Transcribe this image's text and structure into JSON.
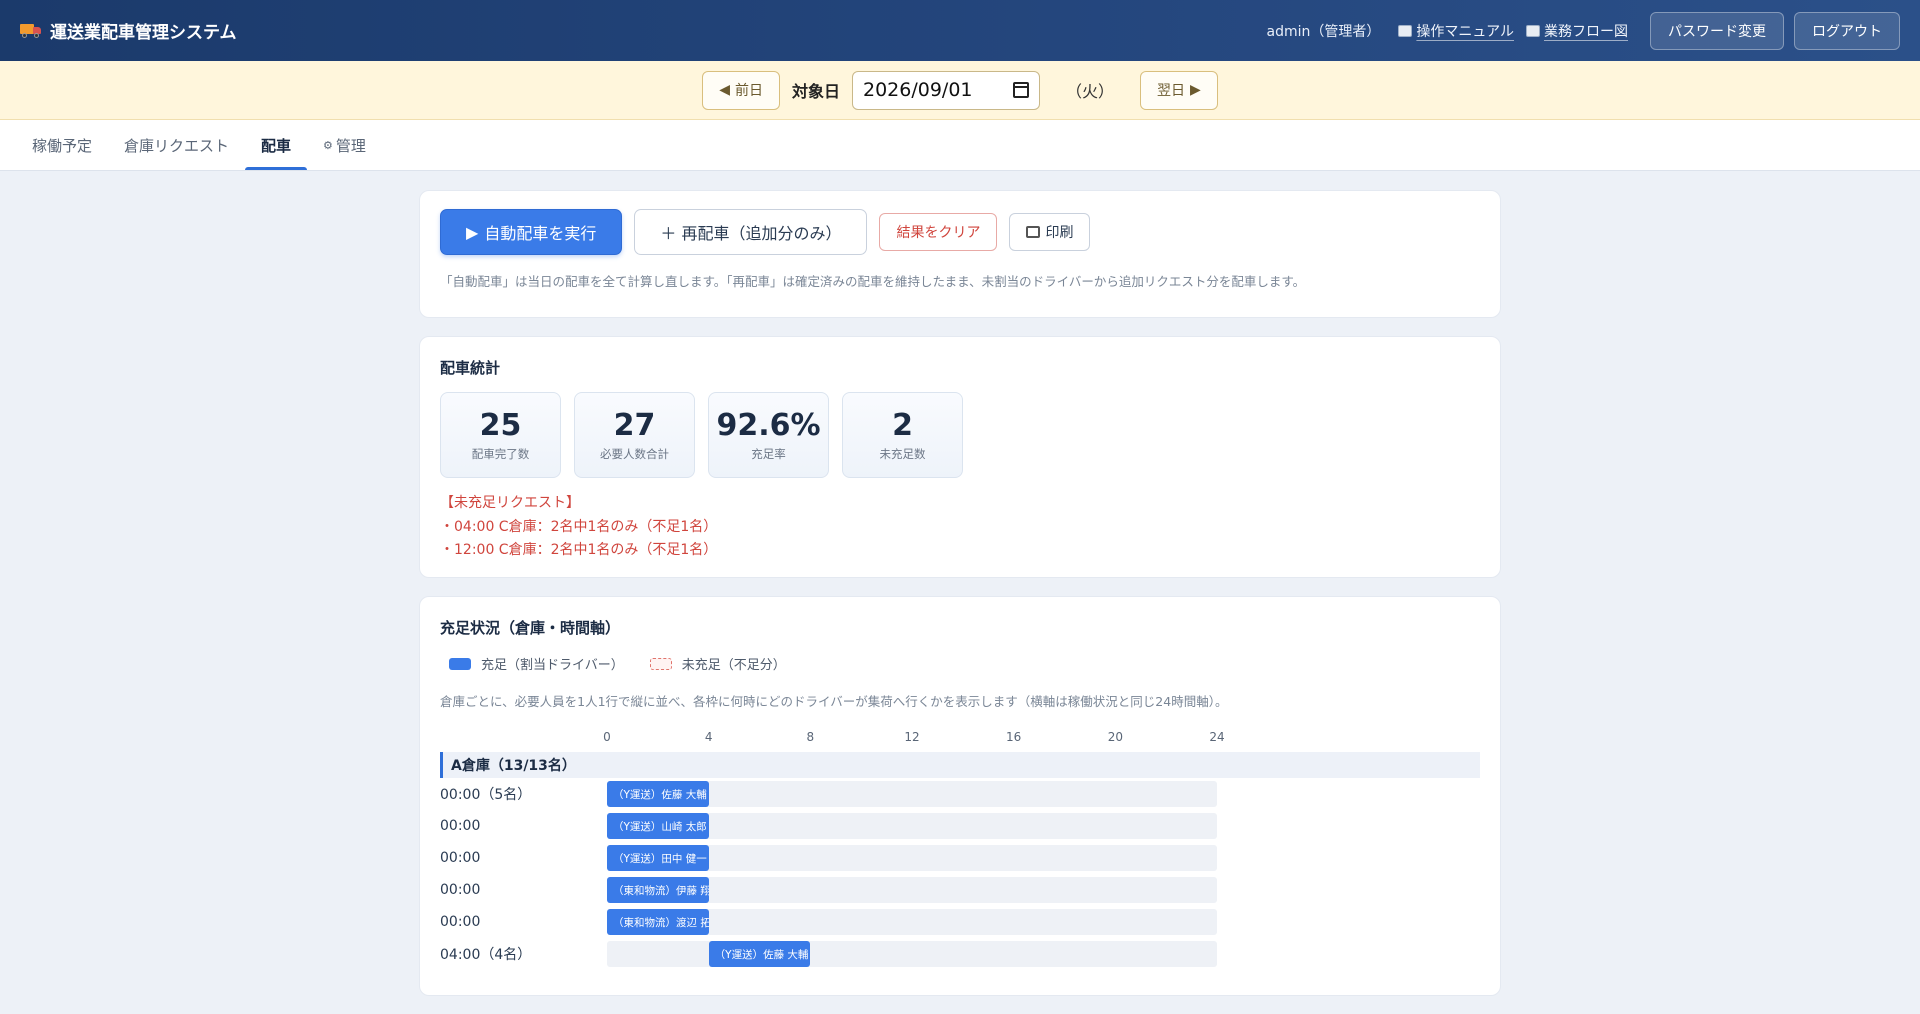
{
  "header": {
    "app_title": "運送業配車管理システム",
    "user": "admin（管理者）",
    "manual_link": "操作マニュアル",
    "flow_link": "業務フロー図",
    "password_button": "パスワード変更",
    "logout_button": "ログアウト"
  },
  "datebar": {
    "prev_label": "前日",
    "date_label": "対象日",
    "date_value": "2026/09/01",
    "weekday": "（火）",
    "next_label": "翌日"
  },
  "tabs": [
    {
      "label": "稼働予定",
      "active": false
    },
    {
      "label": "倉庫リクエスト",
      "active": false
    },
    {
      "label": "配車",
      "active": true
    },
    {
      "label": "管理",
      "active": false
    }
  ],
  "actions": {
    "auto_dispatch": "自動配車を実行",
    "redispatch": "再配車（追加分のみ）",
    "clear": "結果をクリア",
    "print": "印刷",
    "note": "「自動配車」は当日の配車を全て計算し直します。「再配車」は確定済みの配車を維持したまま、未割当のドライバーから追加リクエスト分を配車します。"
  },
  "stats": {
    "title": "配車統計",
    "items": [
      {
        "value": "25",
        "label": "配車完了数"
      },
      {
        "value": "27",
        "label": "必要人数合計"
      },
      {
        "value": "92.6%",
        "label": "充足率"
      },
      {
        "value": "2",
        "label": "未充足数"
      }
    ],
    "shortage_title": "【未充足リクエスト】",
    "shortage_items": [
      "・04:00 C倉庫：2名中1名のみ（不足1名）",
      "・12:00 C倉庫：2名中1名のみ（不足1名）"
    ]
  },
  "fulfillment": {
    "title": "充足状況（倉庫・時間軸）",
    "legend_filled": "充足（割当ドライバー）",
    "legend_unfilled": "未充足（不足分）",
    "description": "倉庫ごとに、必要人員を1人1行で縦に並べ、各枠に何時にどのドライバーが集荷へ行くかを表示します（横軸は稼働状況と同じ24時間軸）。",
    "axis_ticks": [
      "0",
      "4",
      "8",
      "12",
      "16",
      "20",
      "24"
    ],
    "axis_max_hours": 24,
    "groups": [
      {
        "name": "A倉庫（13/13名）",
        "rows": [
          {
            "label": "00:00（5名）",
            "start": 0,
            "end": 4,
            "driver": "（Y運送）佐藤 大輔"
          },
          {
            "label": "00:00",
            "start": 0,
            "end": 4,
            "driver": "（Y運送）山崎 太郎"
          },
          {
            "label": "00:00",
            "start": 0,
            "end": 4,
            "driver": "（Y運送）田中 健一"
          },
          {
            "label": "00:00",
            "start": 0,
            "end": 4,
            "driver": "（東和物流）伊藤 翔"
          },
          {
            "label": "00:00",
            "start": 0,
            "end": 4,
            "driver": "（東和物流）渡辺 拓"
          },
          {
            "label": "04:00（4名）",
            "start": 4,
            "end": 8,
            "driver": "（Y運送）佐藤 大輔"
          }
        ]
      }
    ]
  },
  "colors": {
    "header_bg": "#1b3a6b",
    "accent": "#3a7be8",
    "danger": "#d0453d",
    "datebar_bg": "#fff6dc"
  }
}
